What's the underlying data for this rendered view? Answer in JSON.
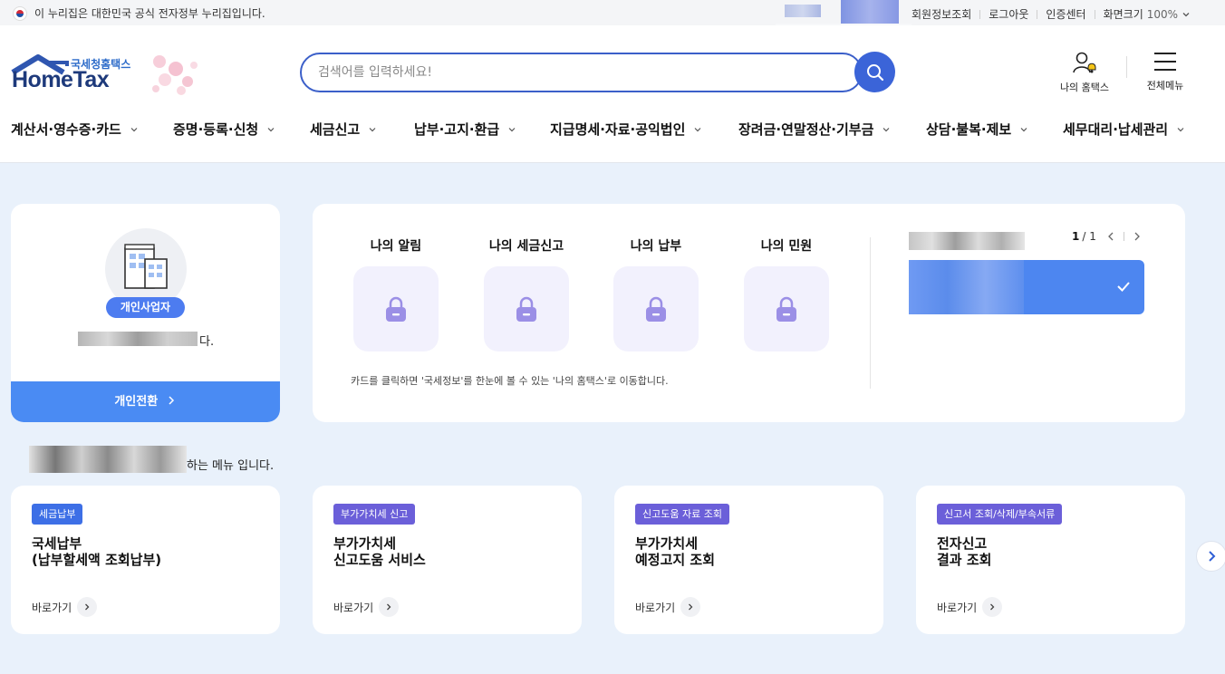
{
  "topbar": {
    "gov_notice": "이 누리집은 대한민국 공식 전자정부 누리집입니다.",
    "links": [
      "회원정보조회",
      "로그아웃",
      "인증센터",
      "화면크기"
    ],
    "zoom": "100%"
  },
  "header": {
    "logo_sub": "국세청홈택스",
    "logo_main": "HomeTax",
    "search_placeholder": "검색어를 입력하세요!",
    "my_hometax": "나의 홈택스",
    "all_menu": "전체메뉴"
  },
  "gnb": [
    "계산서·영수증·카드",
    "증명·등록·신청",
    "세금신고",
    "납부·고지·환급",
    "지급명세·자료·공익법인",
    "장려금·연말정산·기부금",
    "상담·불복·제보",
    "세무대리·납세관리"
  ],
  "profile": {
    "badge": "개인사업자",
    "name_suffix": "다.",
    "switch_label": "개인전환"
  },
  "dashboard": {
    "items": [
      "나의 알림",
      "나의 세금신고",
      "나의 납부",
      "나의 민원"
    ],
    "note": "카드를 클릭하면 '국세정보'를 한눈에 볼 수 있는 '나의 홈택스'로 이동합니다.",
    "pager_current": "1",
    "pager_total": "/ 1"
  },
  "recommend_suffix": "하는 메뉴 입니다.",
  "cards": [
    {
      "tag": "세금납부",
      "tag_color": "#3d6fe6",
      "title": "국세납부\n(납부할세액 조회납부)",
      "go": "바로가기"
    },
    {
      "tag": "부가가치세 신고",
      "tag_color": "#6b5fd9",
      "title": "부가가치세\n신고도움 서비스",
      "go": "바로가기"
    },
    {
      "tag": "신고도움 자료 조회",
      "tag_color": "#6b5fd9",
      "title": "부가가치세\n예정고지 조회",
      "go": "바로가기"
    },
    {
      "tag": "신고서 조회/삭제/부속서류",
      "tag_color": "#6b5fd9",
      "title": "전자신고\n결과 조회",
      "go": "바로가기"
    }
  ],
  "colors": {
    "brand": "#1e3a7b",
    "accent": "#3b64d8",
    "page_bg": "#e9f1fb"
  }
}
